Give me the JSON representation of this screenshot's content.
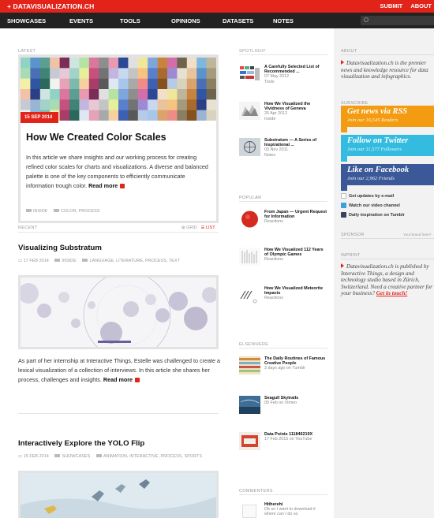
{
  "topbar": {
    "brand": "+ DATAVISUALIZATION.CH",
    "links": [
      "SUBMIT",
      "ABOUT"
    ]
  },
  "nav": {
    "items": [
      "SHOWCASES",
      "EVENTS",
      "TOOLS",
      "OPINIONS",
      "DATASETS",
      "NOTES"
    ]
  },
  "colors": {
    "accent": "#e2231a",
    "nav_bg": "#222222"
  },
  "latest": {
    "heading": "LATEST",
    "date": "15 SEP 2014",
    "title": "How We Created Color Scales",
    "text": "In this article we share insights and our working process for creating refined color scales for charts and visualizations. A diverse and balanced palette is one of the key components to efficiently communicate information trough color.",
    "read_more": "Read more",
    "tags": [
      "INSIDE",
      "COLOR, PROCESS"
    ]
  },
  "recent": {
    "heading": "RECENT",
    "view_grid": "GRID",
    "view_list": "LIST",
    "posts": [
      {
        "title": "Visualizing Substratum",
        "date": "17 FEB 2014",
        "category": "INSIDE",
        "tags": "LANGUAGE, LITERATURE, PROCESS, TEXT",
        "text": "As part of her internship at Interactive Things, Estelle was challenged to create a lexical visualization of a collection of interviews. In this article she shares her process, challenges and insights.",
        "read_more": "Read more"
      },
      {
        "title": "Interactively Explore the YOLO Flip",
        "date": "15 FEB 2014",
        "category": "SHOWCASES",
        "tags": "ANIMATION, INTERACTIVE, PROCESS, SPORTS"
      }
    ]
  },
  "spotlight": {
    "heading": "SPOTLIGHT",
    "items": [
      {
        "title": "A Carefully Selected List of Recommended ...",
        "date": "07 May 2012",
        "cat": "Tools"
      },
      {
        "title": "How We Visualized the Vividness of Geneva",
        "date": "25 Apr 2012",
        "cat": "Inside"
      },
      {
        "title": "Substratum — A Series of Inspirational ...",
        "date": "03 Nov 2011",
        "cat": "Notes"
      }
    ]
  },
  "popular": {
    "heading": "POPULAR",
    "items": [
      {
        "title": "From Japan — Urgent Request for Information",
        "cat": "Reactions"
      },
      {
        "title": "How We Visualized 112 Years of Olympic Games",
        "cat": "Reactions"
      },
      {
        "title": "How We Visualized Meteorite Impacts",
        "cat": "Reactions"
      }
    ]
  },
  "elsewhere": {
    "heading": "ELSEWHERE",
    "items": [
      {
        "title": "The Daily Routines of Famous Creative People",
        "sub": "3 days ago on Tumblr"
      },
      {
        "title": "Seagull Skytrails",
        "sub": "05 Feb on Vimeo"
      },
      {
        "title": "Data Points 111846219X",
        "sub": "17 Feb 2015 on YouTube"
      }
    ]
  },
  "commenters": {
    "heading": "COMMENTERS",
    "name": "Hitherehi",
    "text": "Ok so I want to download it where can I do so"
  },
  "rail": {
    "about_heading": "ABOUT",
    "about_text": "Datavisualization.ch is the premier news and knowledge resource for data visualization and infographics.",
    "subscribe_heading": "SUBSCRIBE",
    "rss_big": "Get news via RSS",
    "rss_small": "Join our 16,545 Readers",
    "twitter_big": "Follow on Twitter",
    "twitter_small": "Join our 11,577 Followers",
    "facebook_big": "Like on Facebook",
    "facebook_small": "Join our 2,962 Friends",
    "email_link": "Get updates by e-mail",
    "video_link": "Watch our video channel",
    "tumblr_link": "Daily inspiration on Tumblr",
    "sponsor_heading": "SPONSOR",
    "sponsor_note": "Your brand here?",
    "imprint_heading": "IMPRINT",
    "imprint_text": "Datavisualization.ch is published by Interactive Things, a design and technology studio based in Zürich, Switzerland.",
    "imprint_question": "Need a creative partner for your business?",
    "imprint_cta": "Get in touch!"
  }
}
